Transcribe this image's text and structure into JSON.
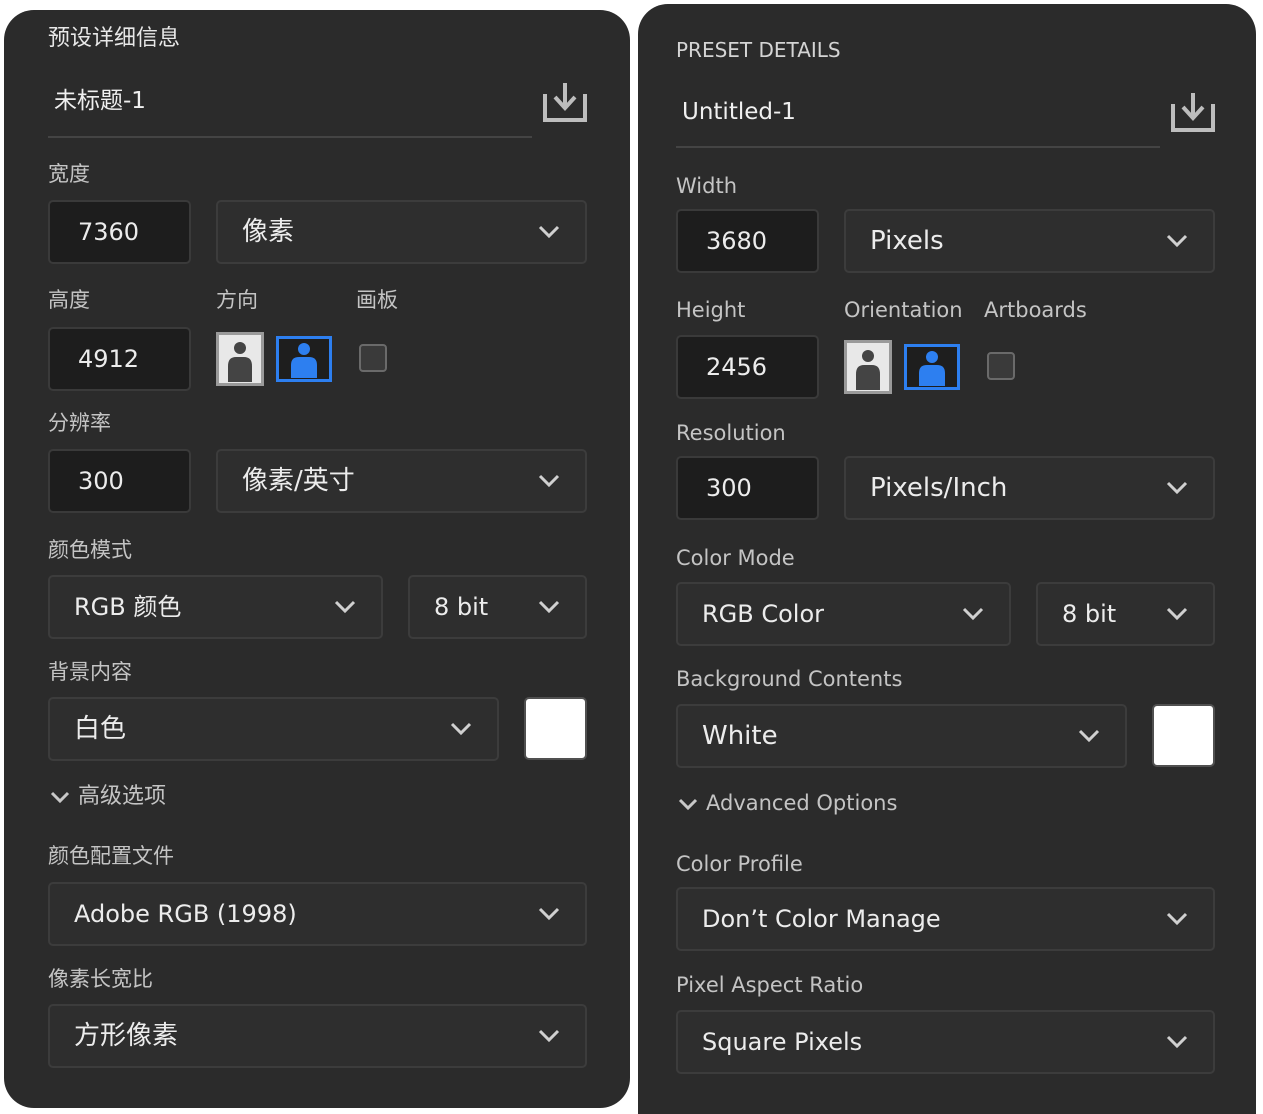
{
  "left": {
    "title": "预设详细信息",
    "doc_name": "未标题-1",
    "width_label": "宽度",
    "width_value": "7360",
    "width_unit": "像素",
    "height_label": "高度",
    "height_value": "4912",
    "orientation_label": "方向",
    "artboards_label": "画板",
    "resolution_label": "分辨率",
    "resolution_value": "300",
    "resolution_unit": "像素/英寸",
    "color_mode_label": "颜色模式",
    "color_mode": "RGB 颜色",
    "bit_depth": "8 bit",
    "background_label": "背景内容",
    "background": "白色",
    "advanced_label": "高级选项",
    "color_profile_label": "颜色配置文件",
    "color_profile": "Adobe RGB (1998)",
    "pixel_aspect_label": "像素长宽比",
    "pixel_aspect": "方形像素"
  },
  "right": {
    "title": "PRESET DETAILS",
    "doc_name": "Untitled-1",
    "width_label": "Width",
    "width_value": "3680",
    "width_unit": "Pixels",
    "height_label": "Height",
    "height_value": "2456",
    "orientation_label": "Orientation",
    "artboards_label": "Artboards",
    "resolution_label": "Resolution",
    "resolution_value": "300",
    "resolution_unit": "Pixels/Inch",
    "color_mode_label": "Color Mode",
    "color_mode": "RGB Color",
    "bit_depth": "8 bit",
    "background_label": "Background Contents",
    "background": "White",
    "advanced_label": "Advanced Options",
    "color_profile_label": "Color Profile",
    "color_profile": "Don’t Color Manage",
    "pixel_aspect_label": "Pixel Aspect Ratio",
    "pixel_aspect": "Square Pixels"
  },
  "icons": {
    "save_preset": "save-preset-icon",
    "chevron": "chevron-down-icon",
    "portrait": "portrait-orientation-icon",
    "landscape": "landscape-orientation-icon"
  },
  "colors": {
    "panel_bg": "#2b2b2b",
    "field_bg": "#1d1d1d",
    "accent_blue": "#2d7ff0",
    "background_swatch": "#ffffff"
  },
  "state": {
    "orientation_selected": "landscape",
    "artboards_checked": false,
    "advanced_expanded": true
  }
}
